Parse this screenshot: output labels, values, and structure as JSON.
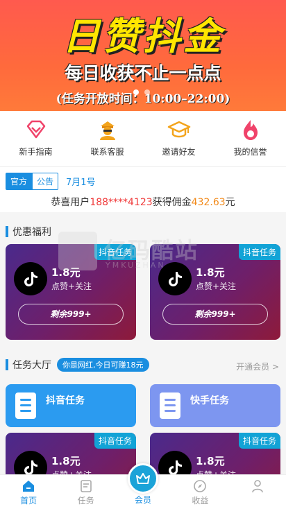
{
  "banner": {
    "title": "日赞抖金",
    "subtitle": "每日收获不止一点点",
    "hours": "(任务开放时间：10:00–22:00)"
  },
  "quick_menu": [
    {
      "label": "新手指南",
      "icon": "diamond-icon",
      "color": "#f0436a"
    },
    {
      "label": "联系客服",
      "icon": "agent-icon",
      "color": "#f3a41c"
    },
    {
      "label": "邀请好友",
      "icon": "graduation-cap-icon",
      "color": "#f3a41c"
    },
    {
      "label": "我的信誉",
      "icon": "flame-icon",
      "color": "#f0436a"
    }
  ],
  "notice": {
    "tag_official": "官方",
    "tag_announce": "公告",
    "date": "7月1号",
    "msg_prefix": "恭喜用户",
    "msg_user": "188****4123",
    "msg_mid": "获得佣金",
    "msg_amount": "432.63",
    "msg_suffix": "元"
  },
  "benefits": {
    "title": "优惠福利",
    "cards": [
      {
        "ribbon": "抖音任务",
        "price": "1.8元",
        "desc": "点赞+关注",
        "remaining": "剩余999+"
      },
      {
        "ribbon": "抖音任务",
        "price": "1.8元",
        "desc": "点赞+关注",
        "remaining": "剩余999+"
      }
    ]
  },
  "hall": {
    "title": "任务大厅",
    "badge": "你是网红,今日可赚18元",
    "more": "开通会员 >",
    "categories": [
      "抖音任务",
      "快手任务"
    ],
    "cards": [
      {
        "ribbon": "抖音任务",
        "price": "1.8元",
        "desc": "点赞+关注"
      },
      {
        "ribbon": "抖音任务",
        "price": "1.8元",
        "desc": "点赞+关注"
      }
    ]
  },
  "watermark": {
    "title": "亿码酷站",
    "sub": "YMKUZHAN"
  },
  "nav": {
    "items": [
      "首页",
      "任务",
      "会员",
      "收益",
      ""
    ],
    "active_color": "#1a8ee0"
  }
}
